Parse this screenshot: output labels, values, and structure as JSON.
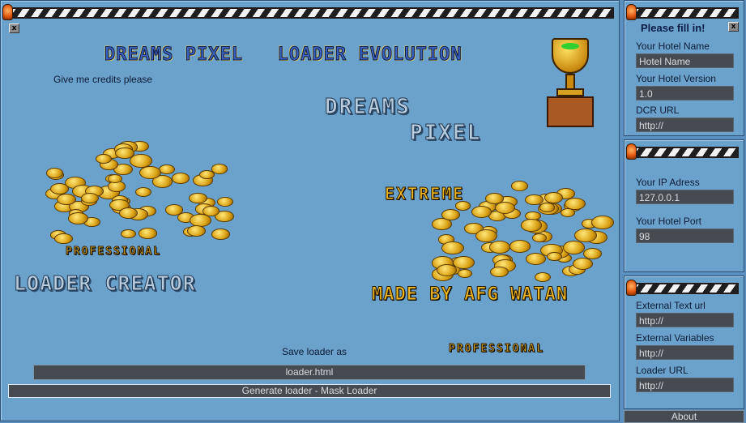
{
  "main": {
    "close_label": "x",
    "title_logo": "Dreams Pixel   Loader Evolution",
    "credits_text": "Give me credits please",
    "logo_dreams": "Dreams",
    "logo_pixel": "Pixel",
    "extreme": "Extreme",
    "professional_small": "Professional",
    "loader_creator": "Loader Creator",
    "made_by": "Made by AFG Watan",
    "professional_bottom": "Professional",
    "save_label": "Save loader as",
    "save_value": "loader.html",
    "generate_button": "Generate loader  - Mask Loader"
  },
  "panel1": {
    "title": "Please fill in!",
    "close_label": "x",
    "fields": [
      {
        "label": "Your Hotel Name",
        "value": "Hotel Name"
      },
      {
        "label": "Your Hotel Version",
        "value": "1.0"
      },
      {
        "label": "DCR URL",
        "value": "http://"
      }
    ]
  },
  "panel2": {
    "fields": [
      {
        "label": "Your IP Adress",
        "value": "127.0.0.1"
      },
      {
        "label": "Your Hotel Port",
        "value": "98"
      }
    ]
  },
  "panel3": {
    "fields": [
      {
        "label": "External Text url",
        "value": "http://"
      },
      {
        "label": "External Variables",
        "value": "http://"
      },
      {
        "label": "Loader URL",
        "value": "http://"
      }
    ]
  },
  "about_button": "About",
  "colors": {
    "panel": "#6ba2cc",
    "field": "#454b51",
    "gold": "#f0b820"
  }
}
